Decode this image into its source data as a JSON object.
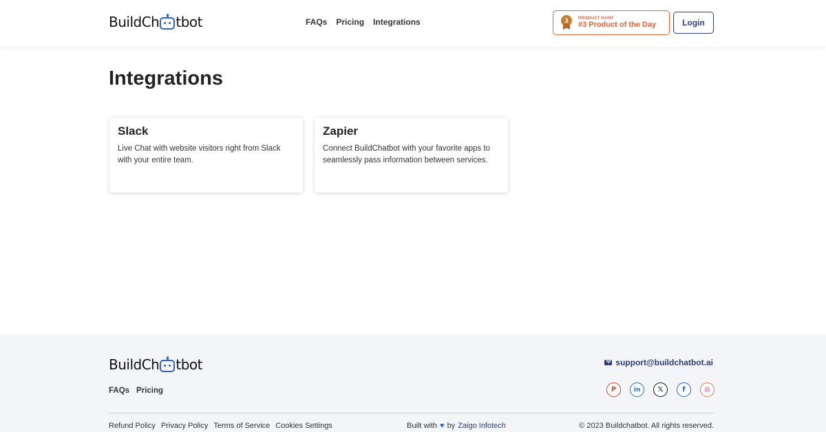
{
  "header": {
    "logo": {
      "prefix": "BuildCh",
      "suffix": "tbot"
    },
    "nav": [
      "FAQs",
      "Pricing",
      "Integrations"
    ],
    "product_hunt": {
      "small": "PRODUCT HUNT",
      "big": "#3 Product of the Day",
      "medal_number": "3"
    },
    "login_label": "Login"
  },
  "main": {
    "title": "Integrations",
    "cards": [
      {
        "title": "Slack",
        "description": "Live Chat with website visitors right from Slack with your entire team."
      },
      {
        "title": "Zapier",
        "description": "Connect BuildChatbot with your favorite apps to seamlessly pass information between services."
      }
    ]
  },
  "footer": {
    "logo": {
      "prefix": "BuildCh",
      "suffix": "tbot"
    },
    "nav": [
      "FAQs",
      "Pricing"
    ],
    "email": "support@buildchatbot.ai",
    "socials": [
      {
        "name": "pinterest",
        "glyph": "P"
      },
      {
        "name": "linkedin",
        "glyph": "in"
      },
      {
        "name": "x",
        "glyph": "𝕏"
      },
      {
        "name": "facebook",
        "glyph": "f"
      },
      {
        "name": "instagram",
        "glyph": "◎"
      }
    ],
    "bottom_links": [
      "Refund Policy",
      "Privacy Policy",
      "Terms of Service",
      "Cookies Settings"
    ],
    "built_with": {
      "prefix": "Built with",
      "by": "by",
      "company": "Zaigo Infotech"
    },
    "copyright": "© 2023 Buildchatbot. All rights reserved."
  },
  "colors": {
    "brand_blue": "#2f62d6",
    "navy": "#2a3f7a",
    "product_hunt_orange": "#e8623b"
  }
}
